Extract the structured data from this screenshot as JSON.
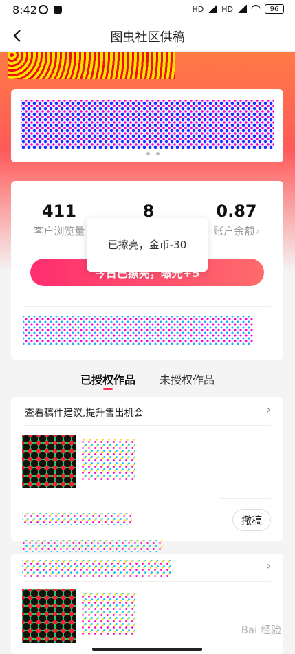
{
  "status_bar": {
    "time": "8:42",
    "battery": "96",
    "network_label": "HD"
  },
  "header": {
    "title": "图虫社区供稿"
  },
  "stats": {
    "views_value": "411",
    "views_label": "客户浏览量",
    "middle_value": "8",
    "balance_value": "0.87",
    "balance_label": "账户余额"
  },
  "popup": {
    "text": "已擦亮，金币-30"
  },
  "shine_button": {
    "label": "今日已擦亮，曝光+5"
  },
  "tabs": [
    {
      "label": "已授权作品",
      "active": true
    },
    {
      "label": "未授权作品",
      "active": false
    }
  ],
  "work_cards": [
    {
      "heading": "查看稿件建议,提升售出机会",
      "action_label": "撤稿"
    }
  ],
  "watermark": {
    "text": "Bai 经验"
  },
  "colors": {
    "accent": "#ff2d55",
    "gradient_start": "#ff7a45",
    "gradient_end": "#ff5a5a"
  }
}
